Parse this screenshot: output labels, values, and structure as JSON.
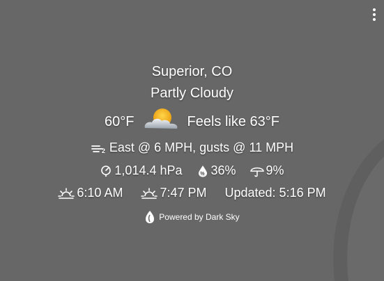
{
  "weather": {
    "location": "Superior, CO",
    "condition": "Partly Cloudy",
    "temperature": "60°F",
    "feels_like": "Feels like 63°F",
    "condition_icon": "partly-cloudy-day-icon",
    "wind": "East @ 6 MPH, gusts @ 11 MPH",
    "pressure": "1,014.4 hPa",
    "humidity": "36%",
    "precip_probability": "9%",
    "sunrise": "6:10 AM",
    "sunset": "7:47 PM",
    "updated": "Updated: 5:16 PM"
  },
  "footer": {
    "powered_by": "Powered by Dark Sky"
  },
  "icons": {
    "menu": "more-vertical-icon",
    "wind": "wind-icon",
    "pressure": "barometer-icon",
    "humidity": "humidity-icon",
    "precip": "umbrella-icon",
    "sunrise": "sunrise-icon",
    "sunset": "sunset-icon",
    "brand": "dark-sky-logo-icon"
  },
  "colors": {
    "background": "#676767",
    "text": "#ffffff",
    "sun": "#f6b31a",
    "cloud": "#d9dde3"
  }
}
